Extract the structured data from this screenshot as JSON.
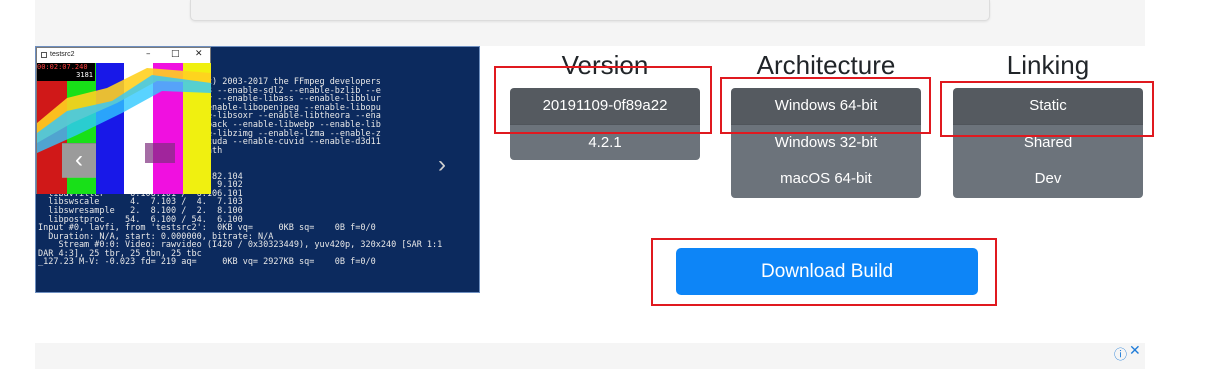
{
  "ad": {
    "info_icon": "ⓘ",
    "close_icon": "✕"
  },
  "screenshot": {
    "window_title": "testsrc2",
    "osd_time": "00:02:07.240",
    "osd_frame": "3181",
    "terminal_lines": [
      "                   3f Copyright (c) 2003-2017 the FFmpeg developers",
      "",
      "                   enable-version3 --enable-sdl2 --enable-bzlib --e",
      "                    --enable-iconv --enable-libass --enable-libblur",
      "                   -libmp3lame --enable-libopenjpeg --enable-libopu",
      "                   snappy --enable-libsoxr --enable-libtheora --ena",
      "                   -enable-libwavpack --enable-libwebp --enable-lib",
      "                   ibxml2 --enable-libzimg --enable-lzma --enable-z",
      "                   stab --enable-cuda --enable-cuvid --enable-d3d11",
      "                   --enable-avisynth",
      "                   . 77.101",
      "                   .106.104",
      "  libavformat    57. 82.104 / 57. 82.104",
      "  libavdevice    57.  9.102 / 57.  9.102",
      "  libavfilter     6.106.101 /  6.106.101",
      "  libswscale      4.  7.103 /  4.  7.103",
      "  libswresample   2.  8.100 /  2.  8.100",
      "  libpostproc    54.  6.100 / 54.  6.100",
      "Input #0, lavfi, from 'testsrc2':  0KB vq=     0KB sq=    0B f=0/0",
      "  Duration: N/A, start: 0.000000, bitrate: N/A",
      "    Stream #0:0: Video: rawvideo (I420 / 0x30323449), yuv420p, 320x240 [SAR 1:1",
      "DAR 4:3], 25 tbr, 25 tbn, 25 tbc",
      "_127.23 M-V: -0.023 fd= 219 aq=     0KB vq= 2927KB sq=    0B f=0/0"
    ]
  },
  "version": {
    "heading": "Version",
    "options": [
      "20191109-0f89a22",
      "4.2.1"
    ],
    "selected": "20191109-0f89a22"
  },
  "architecture": {
    "heading": "Architecture",
    "options": [
      "Windows 64-bit",
      "Windows 32-bit",
      "macOS 64-bit"
    ],
    "selected": "Windows 64-bit"
  },
  "linking": {
    "heading": "Linking",
    "options": [
      "Static",
      "Shared",
      "Dev"
    ],
    "selected": "Static"
  },
  "download": {
    "label": "Download Build",
    "color": "#0d85f7"
  },
  "colors": {
    "highlight": "#e0191f",
    "active_option": "#555a60",
    "inactive_option": "#6c737b"
  }
}
